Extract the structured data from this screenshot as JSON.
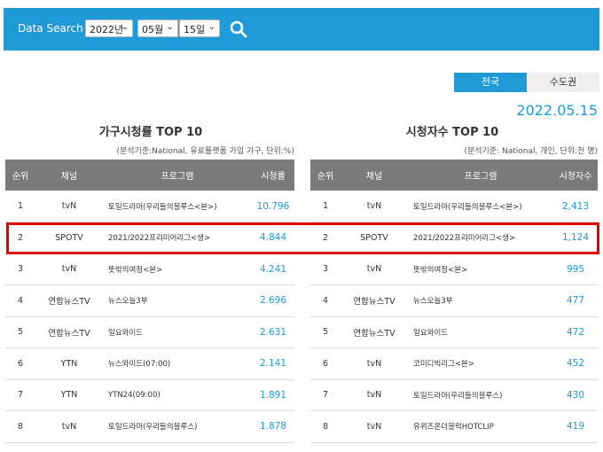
{
  "header": {
    "label": "Data Search",
    "year": "2022년",
    "month": "05월",
    "day": "15일",
    "search_icon": "search-icon"
  },
  "tabs": {
    "active": "전국",
    "inactive": "수도권"
  },
  "date": "2022.05.15",
  "household": {
    "title": "가구시청률 TOP 10",
    "note": "(분석기준:National, 유료플랫폼 가입 가구, 단위:%)",
    "columns": [
      "순위",
      "채널",
      "프로그램",
      "시청률"
    ],
    "rows": [
      {
        "rank": "1",
        "channel": "tvN",
        "program": "토일드라마(우리들의블루스<본>)",
        "value": "10.796"
      },
      {
        "rank": "2",
        "channel": "SPOTV",
        "program": "2021/2022프리미어리그<생>",
        "value": "4.844"
      },
      {
        "rank": "3",
        "channel": "tvN",
        "program": "뜻밖의여정<본>",
        "value": "4.241"
      },
      {
        "rank": "4",
        "channel": "연합뉴스TV",
        "program": "뉴스오늘3부",
        "value": "2.696"
      },
      {
        "rank": "5",
        "channel": "연합뉴스TV",
        "program": "일요와이드",
        "value": "2.631"
      },
      {
        "rank": "6",
        "channel": "YTN",
        "program": "뉴스와이드(07:00)",
        "value": "2.141"
      },
      {
        "rank": "7",
        "channel": "YTN",
        "program": "YTN24(09:00)",
        "value": "1.891"
      },
      {
        "rank": "8",
        "channel": "tvN",
        "program": "토일드라마(우리들의블루스)",
        "value": "1.878"
      }
    ]
  },
  "viewers": {
    "title": "시청자수 TOP 10",
    "note": "(분석기준: National, 개인, 단위:천 명)",
    "columns": [
      "순위",
      "채널",
      "프로그램",
      "시청자수"
    ],
    "rows": [
      {
        "rank": "1",
        "channel": "tvN",
        "program": "토일드라마(우리들의블루스<본>)",
        "value": "2,413"
      },
      {
        "rank": "2",
        "channel": "SPOTV",
        "program": "2021/2022프리미어리그<생>",
        "value": "1,124"
      },
      {
        "rank": "3",
        "channel": "tvN",
        "program": "뜻밖의여정<본>",
        "value": "995"
      },
      {
        "rank": "4",
        "channel": "연합뉴스TV",
        "program": "뉴스오늘3부",
        "value": "477"
      },
      {
        "rank": "5",
        "channel": "연합뉴스TV",
        "program": "일요와이드",
        "value": "472"
      },
      {
        "rank": "6",
        "channel": "tvN",
        "program": "코미디빅리그<본>",
        "value": "452"
      },
      {
        "rank": "7",
        "channel": "tvN",
        "program": "토일드라마(우리들의블루스)",
        "value": "430"
      },
      {
        "rank": "8",
        "channel": "tvN",
        "program": "유퀴즈온더블럭HOTCLIP",
        "value": "419"
      }
    ]
  }
}
